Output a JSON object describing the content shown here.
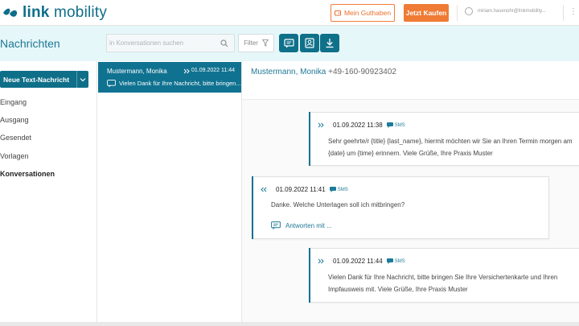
{
  "header": {
    "logo_text_bold": "link",
    "logo_text_rest": " mobility",
    "guthaben_label": "Mein Guthaben",
    "kaufen_label": "Jetzt Kaufen",
    "user_email": "miriam.hasenohr@linkmobility...",
    "colors": {
      "brand": "#0d6e8a",
      "accent": "#ef7b34"
    }
  },
  "toolbar": {
    "title": "Nachrichten",
    "search_placeholder": "in Konversationen suchen",
    "filter_label": "Filter",
    "icons": [
      "message-icon",
      "contact-card-icon",
      "download-icon"
    ]
  },
  "sidebar": {
    "new_message_label": "Neue Text-Nachricht",
    "items": [
      {
        "label": "Eingang",
        "active": false
      },
      {
        "label": "Ausgang",
        "active": false
      },
      {
        "label": "Gesendet",
        "active": false
      },
      {
        "label": "Vorlagen",
        "active": false
      },
      {
        "label": "Konversationen",
        "active": true
      }
    ]
  },
  "conversations": [
    {
      "name": "Mustermann, Monika",
      "date": "01.09.2022 11:44",
      "snippet": "Vielen Dank für Ihre Nachricht, bitte bringen..."
    }
  ],
  "thread": {
    "contact_name": "Mustermann, Monika",
    "contact_number": "+49-160-90923402",
    "messages": [
      {
        "direction": "outgoing",
        "timestamp": "01.09.2022 11:38",
        "channel": "SMS",
        "lines": [
          "Sehr geehrte/r {title} {last_name}, hiermit möchten wir Sie an Ihren Termin morgen am",
          "{date} um {time} erinnern. Viele Grüße, Ihre Praxis Muster"
        ]
      },
      {
        "direction": "incoming",
        "timestamp": "01.09.2022 11:41",
        "channel": "SMS",
        "lines": [
          "Danke. Welche Unterlagen soll ich mitbringen?"
        ],
        "reply_label": "Antworten mit ..."
      },
      {
        "direction": "outgoing",
        "timestamp": "01.09.2022 11:44",
        "channel": "SMS",
        "lines": [
          "Vielen Dank für Ihre Nachricht, bitte bringen Sie Ihre Versichertenkarte und Ihren",
          "Impfausweis mit. Viele Grüße, Ihre Praxis Muster"
        ]
      }
    ]
  }
}
